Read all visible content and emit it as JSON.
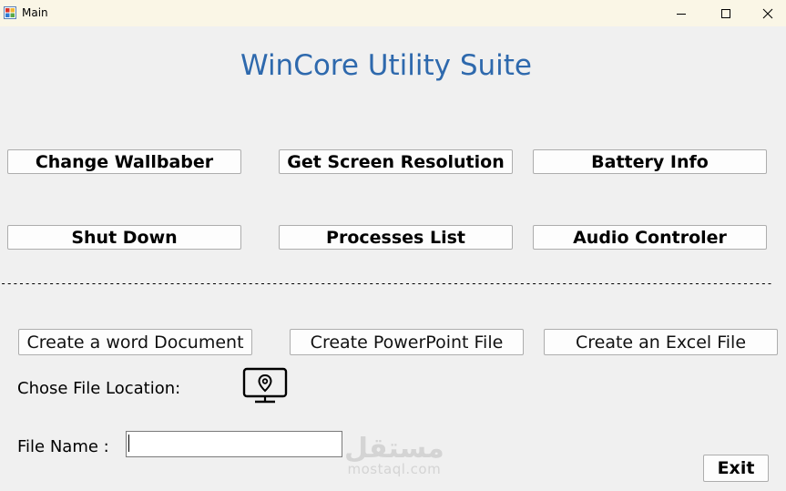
{
  "window": {
    "title": "Main",
    "icon": "app-window-icon",
    "controls": [
      "minimize-icon",
      "maximize-icon",
      "close-icon"
    ]
  },
  "heading": "WinCore Utility Suite",
  "colors": {
    "heading": "#2e69ad",
    "titlebar": "#faf6e6",
    "background": "#f0f0f0"
  },
  "system_buttons": {
    "change_wallpaper": "Change Wallbaber",
    "screen_resolution": "Get Screen Resolution",
    "battery_info": "Battery Info",
    "shut_down": "Shut Down",
    "processes_list": "Processes List",
    "audio_controller": "Audio Controler"
  },
  "divider": "----------------------------------------------------------------------------------------------------------------------------------------------------------------",
  "file_buttons": {
    "word": "Create a word Document",
    "powerpoint": "Create PowerPoint File",
    "excel": "Create an Excel File"
  },
  "file_location": {
    "label": "Chose File Location:",
    "icon": "location-monitor-icon"
  },
  "file_name": {
    "label": "File Name :",
    "value": ""
  },
  "watermark": {
    "logo": "مستقل",
    "url": "mostaql.com"
  },
  "exit_label": "Exit"
}
